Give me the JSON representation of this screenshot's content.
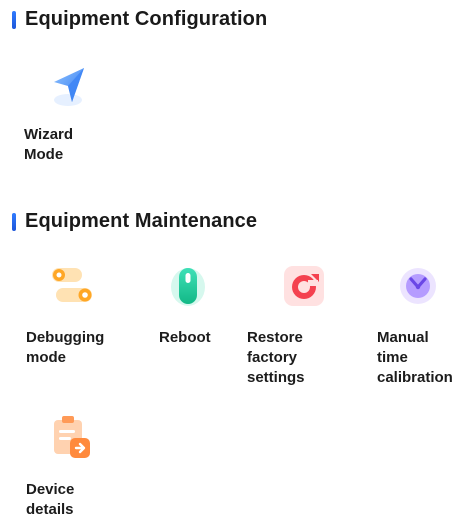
{
  "colors": {
    "accent_bar": "#2f7bff",
    "text": "#1c1c1c",
    "background": "#ffffff"
  },
  "sections": {
    "configuration": {
      "title": "Equipment Configuration",
      "items": [
        {
          "label_lines": [
            "Wizard",
            "Mode"
          ],
          "icon": "navigation-arrow-icon"
        }
      ]
    },
    "maintenance": {
      "title": "Equipment Maintenance",
      "items": [
        {
          "label_lines": [
            "Debugging",
            "mode"
          ],
          "icon": "toggle-switches-icon"
        },
        {
          "label_lines": [
            "Reboot"
          ],
          "icon": "power-icon"
        },
        {
          "label_lines": [
            "Restore",
            "factory",
            "settings"
          ],
          "icon": "restore-icon"
        },
        {
          "label_lines": [
            "Manual",
            "time",
            "calibration"
          ],
          "icon": "clock-icon"
        },
        {
          "label_lines": [
            "Device",
            "details"
          ],
          "icon": "clipboard-details-icon"
        }
      ]
    }
  }
}
